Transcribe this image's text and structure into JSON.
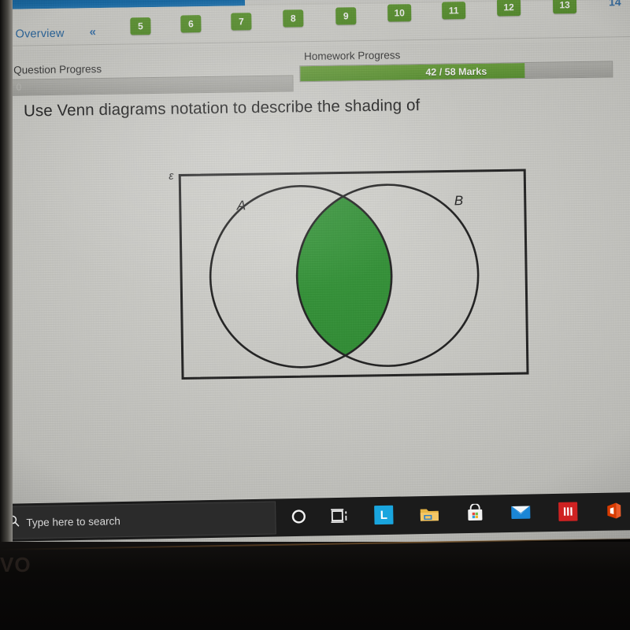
{
  "app": {
    "nav": {
      "overview_label": "Overview",
      "collapse_icon": "«",
      "question_badges": [
        "5",
        "6",
        "7",
        "8",
        "9",
        "10",
        "11",
        "12",
        "13"
      ],
      "current_question": "14"
    },
    "progress": {
      "question": {
        "label": "Question Progress",
        "value_text": "0",
        "percent": 0
      },
      "homework": {
        "label": "Homework Progress",
        "value_text": "42 / 58 Marks",
        "marks_earned": 42,
        "marks_total": 58,
        "percent": 72
      }
    },
    "question": {
      "text": "Use Venn diagrams notation to describe the shading of"
    },
    "venn": {
      "universal_label": "ε",
      "set_a_label": "A",
      "set_b_label": "B",
      "shaded_region": "intersection",
      "shade_color": "#2f9233",
      "outline_color": "#222222"
    }
  },
  "taskbar": {
    "search_placeholder": "Type here to search",
    "items": [
      {
        "name": "cortana-icon",
        "label": ""
      },
      {
        "name": "task-view-icon",
        "label": ""
      },
      {
        "name": "app-l-icon",
        "label": "L",
        "color": "#19a5de"
      },
      {
        "name": "file-explorer-icon",
        "label": ""
      },
      {
        "name": "microsoft-store-icon",
        "label": ""
      },
      {
        "name": "mail-icon",
        "label": ""
      },
      {
        "name": "app-iii-icon",
        "label": "III",
        "color": "#cf2222"
      },
      {
        "name": "office-icon",
        "label": ""
      }
    ]
  },
  "device": {
    "bezel_logo": "VO"
  },
  "colors": {
    "badge_green": "#5d9732",
    "progress_green": "#5d9733",
    "link_blue": "#2f6ea8",
    "browser_blue": "#1b74b4",
    "page_background": "#d4d4cf"
  }
}
